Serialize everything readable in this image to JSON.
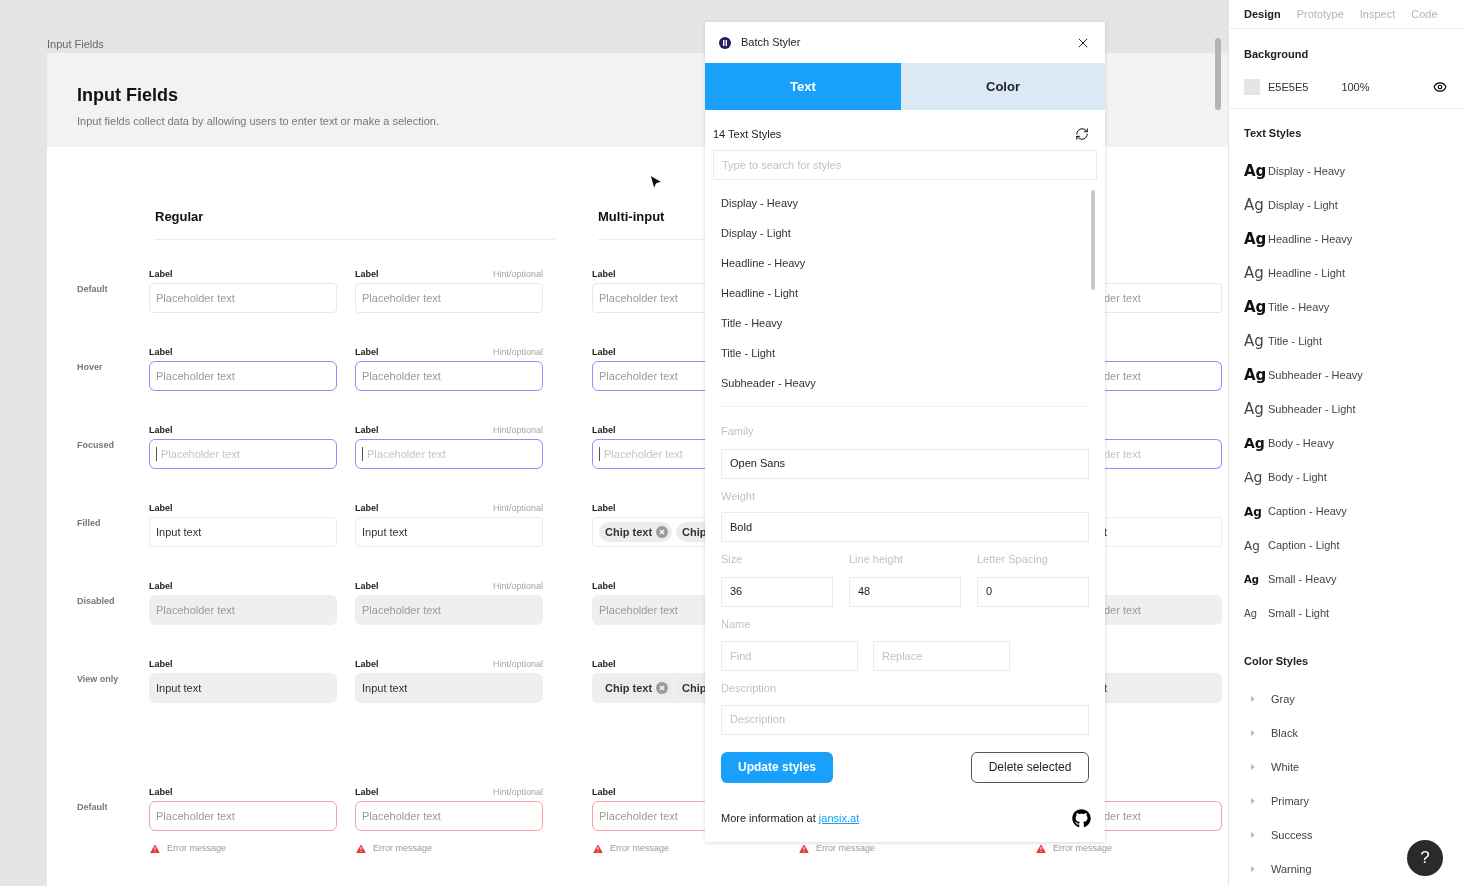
{
  "canvas": {
    "frame_label": "Input Fields",
    "header": {
      "title": "Input Fields",
      "description": "Input fields collect data by allowing users to enter text or make a selection."
    },
    "sections": [
      {
        "title": "Regular"
      },
      {
        "title": "Multi-input"
      }
    ],
    "rows": [
      {
        "state_label": "Default",
        "kind": "default",
        "cells": [
          {
            "label": "Label",
            "text": "Placeholder text"
          },
          {
            "label": "Label",
            "hint": "Hint/optional",
            "text": "Placeholder text"
          },
          {
            "label": "Label",
            "text": "Placeholder text"
          }
        ],
        "edge_text": "der text"
      },
      {
        "state_label": "Hover",
        "kind": "hover",
        "cells": [
          {
            "label": "Label",
            "text": "Placeholder text"
          },
          {
            "label": "Label",
            "hint": "Hint/optional",
            "text": "Placeholder text"
          },
          {
            "label": "Label",
            "text": "Placeholder text"
          }
        ],
        "edge_text": "der text"
      },
      {
        "state_label": "Focused",
        "kind": "focused",
        "cells": [
          {
            "label": "Label",
            "text": "Placeholder text"
          },
          {
            "label": "Label",
            "hint": "Hint/optional",
            "text": "Placeholder text"
          },
          {
            "label": "Label",
            "text": "Placeholder text"
          }
        ],
        "edge_text": "der text"
      },
      {
        "state_label": "Filled",
        "kind": "filled",
        "cells": [
          {
            "label": "Label",
            "text": "Input text"
          },
          {
            "label": "Label",
            "hint": "Hint/optional",
            "text": "Input text"
          },
          {
            "label": "Label",
            "chips": [
              {
                "text": "Chip text"
              },
              {
                "text": "Chip"
              }
            ]
          }
        ],
        "edge_text": "t"
      },
      {
        "state_label": "Disabled",
        "kind": "disabled",
        "cells": [
          {
            "label": "Label",
            "text": "Placeholder text"
          },
          {
            "label": "Label",
            "hint": "Hint/optional",
            "text": "Placeholder text"
          },
          {
            "label": "Label",
            "text": "Placeholder text"
          }
        ],
        "edge_text": "der text"
      },
      {
        "state_label": "View only",
        "kind": "view_only",
        "cells": [
          {
            "label": "Label",
            "text": "Input text"
          },
          {
            "label": "Label",
            "hint": "Hint/optional",
            "text": "Input text"
          },
          {
            "label": "Label",
            "chips": [
              {
                "text": "Chip text"
              },
              {
                "text": "Chip"
              }
            ]
          }
        ],
        "edge_text": "t"
      },
      {
        "state_label": "Default",
        "kind": "error",
        "cells": [
          {
            "label": "Label",
            "text": "Placeholder text"
          },
          {
            "label": "Label",
            "hint": "Hint/optional",
            "text": "Placeholder text"
          },
          {
            "label": "Label",
            "text": "Placeholder text"
          }
        ],
        "edge_text": "der text",
        "errors": [
          "Error message",
          "Error message",
          "Error message",
          "Error message",
          "Error message"
        ]
      }
    ]
  },
  "plugin": {
    "title": "Batch Styler",
    "tabs": [
      {
        "label": "Text",
        "selected": true
      },
      {
        "label": "Color",
        "selected": false
      }
    ],
    "count": "14 Text Styles",
    "search": {
      "placeholder": "Type to search for styles"
    },
    "styles": [
      "Display - Heavy",
      "Display - Light",
      "Headline - Heavy",
      "Headline - Light",
      "Title - Heavy",
      "Title - Light",
      "Subheader - Heavy"
    ],
    "family": {
      "label": "Family",
      "value": "Open Sans"
    },
    "weight": {
      "label": "Weight",
      "value": "Bold"
    },
    "metrics": [
      {
        "label": "Size",
        "value": "36"
      },
      {
        "label": "Line height",
        "value": "48"
      },
      {
        "label": "Letter Spacing",
        "value": "0"
      }
    ],
    "name": {
      "label": "Name",
      "find_placeholder": "Find",
      "replace_placeholder": "Replace"
    },
    "description": {
      "label": "Description",
      "placeholder": "Description"
    },
    "update_button": "Update styles",
    "delete_button": "Delete selected",
    "footer": {
      "text": "More information at",
      "link": "jansix.at"
    }
  },
  "sidebar": {
    "tabs": [
      {
        "label": "Design",
        "selected": true
      },
      {
        "label": "Prototype",
        "selected": false
      },
      {
        "label": "Inspect",
        "selected": false
      },
      {
        "label": "Code",
        "selected": false
      }
    ],
    "background": {
      "heading": "Background",
      "hex": "E5E5E5",
      "opacity": "100%"
    },
    "text_styles_heading": "Text Styles",
    "text_styles": [
      {
        "sample": "Ag",
        "name": "Display - Heavy",
        "heavy": true,
        "kind": "lg"
      },
      {
        "sample": "Ag",
        "name": "Display - Light",
        "heavy": false,
        "kind": "lg"
      },
      {
        "sample": "Ag",
        "name": "Headline - Heavy",
        "heavy": true,
        "kind": "lg"
      },
      {
        "sample": "Ag",
        "name": "Headline - Light",
        "heavy": false,
        "kind": "lg"
      },
      {
        "sample": "Ag",
        "name": "Title - Heavy",
        "heavy": true,
        "kind": "lg"
      },
      {
        "sample": "Ag",
        "name": "Title - Light",
        "heavy": false,
        "kind": "lg"
      },
      {
        "sample": "Ag",
        "name": "Subheader - Heavy",
        "heavy": true,
        "kind": "lg"
      },
      {
        "sample": "Ag",
        "name": "Subheader - Light",
        "heavy": false,
        "kind": "lg"
      },
      {
        "sample": "Ag",
        "name": "Body - Heavy",
        "heavy": true,
        "kind": "md"
      },
      {
        "sample": "Ag",
        "name": "Body - Light",
        "heavy": false,
        "kind": "md"
      },
      {
        "sample": "Ag",
        "name": "Caption - Heavy",
        "heavy": true,
        "kind": "sm"
      },
      {
        "sample": "Ag",
        "name": "Caption - Light",
        "heavy": false,
        "kind": "sm"
      },
      {
        "sample": "Ag",
        "name": "Small - Heavy",
        "heavy": true,
        "kind": "xs"
      },
      {
        "sample": "Ag",
        "name": "Small - Light",
        "heavy": false,
        "kind": "xs"
      }
    ],
    "color_styles_heading": "Color Styles",
    "color_styles": [
      {
        "name": "Gray",
        "expanded": false
      },
      {
        "name": "Black",
        "expanded": false
      },
      {
        "name": "White",
        "expanded": false
      },
      {
        "name": "Primary",
        "expanded": false
      },
      {
        "name": "Success",
        "expanded": false
      },
      {
        "name": "Warning",
        "expanded": false
      }
    ],
    "help": "?"
  }
}
